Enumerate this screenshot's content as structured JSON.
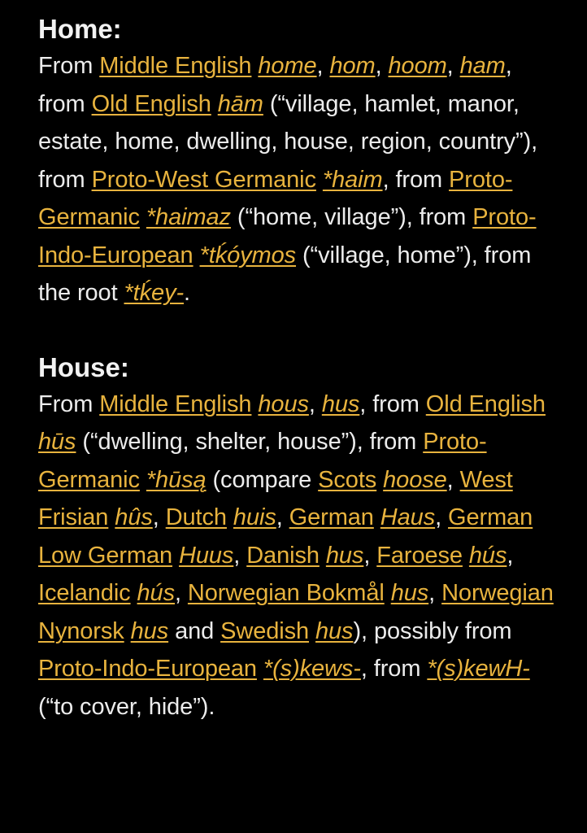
{
  "colors": {
    "background": "#000000",
    "text": "#ececec",
    "link": "#e8b33e"
  },
  "home": {
    "heading": "Home:",
    "body": [
      {
        "t": "From "
      },
      {
        "t": "Middle English",
        "link": true
      },
      {
        "t": " "
      },
      {
        "t": "home",
        "link": true,
        "italic": true
      },
      {
        "t": ", "
      },
      {
        "t": "hom",
        "link": true,
        "italic": true
      },
      {
        "t": ", "
      },
      {
        "t": "hoom",
        "link": true,
        "italic": true
      },
      {
        "t": ", "
      },
      {
        "t": "ham",
        "link": true,
        "italic": true
      },
      {
        "t": ", from "
      },
      {
        "t": "Old English",
        "link": true
      },
      {
        "t": " "
      },
      {
        "t": "hām",
        "link": true,
        "italic": true
      },
      {
        "t": " (“village, hamlet, manor, estate, home, dwelling, house, region, country”), from "
      },
      {
        "t": "Proto-West Germanic",
        "link": true
      },
      {
        "t": " "
      },
      {
        "t": "*haim",
        "link": true,
        "italic": true
      },
      {
        "t": ", from "
      },
      {
        "t": "Proto-Germanic",
        "link": true
      },
      {
        "t": " "
      },
      {
        "t": "*haimaz",
        "link": true,
        "italic": true
      },
      {
        "t": " (“home, village”), from "
      },
      {
        "t": "Proto-Indo-European",
        "link": true
      },
      {
        "t": " "
      },
      {
        "t": "*tḱóymos",
        "link": true,
        "italic": true
      },
      {
        "t": " (“village, home”), from the root "
      },
      {
        "t": "*tḱey-",
        "link": true,
        "italic": true
      },
      {
        "t": "."
      }
    ]
  },
  "house": {
    "heading": "House:",
    "body": [
      {
        "t": "From "
      },
      {
        "t": "Middle English",
        "link": true
      },
      {
        "t": " "
      },
      {
        "t": "hous",
        "link": true,
        "italic": true
      },
      {
        "t": ", "
      },
      {
        "t": "hus",
        "link": true,
        "italic": true
      },
      {
        "t": ", from "
      },
      {
        "t": "Old English",
        "link": true
      },
      {
        "t": " "
      },
      {
        "t": "hūs",
        "link": true,
        "italic": true
      },
      {
        "t": " (“dwelling, shelter, house”), from "
      },
      {
        "t": "Proto-Germanic",
        "link": true
      },
      {
        "t": " "
      },
      {
        "t": "*hūsą",
        "link": true,
        "italic": true
      },
      {
        "t": " (compare "
      },
      {
        "t": "Scots",
        "link": true
      },
      {
        "t": " "
      },
      {
        "t": "hoose",
        "link": true,
        "italic": true
      },
      {
        "t": ", "
      },
      {
        "t": "West Frisian",
        "link": true
      },
      {
        "t": " "
      },
      {
        "t": "hûs",
        "link": true,
        "italic": true
      },
      {
        "t": ", "
      },
      {
        "t": "Dutch",
        "link": true
      },
      {
        "t": " "
      },
      {
        "t": "huis",
        "link": true,
        "italic": true
      },
      {
        "t": ", "
      },
      {
        "t": "German",
        "link": true
      },
      {
        "t": " "
      },
      {
        "t": "Haus",
        "link": true,
        "italic": true
      },
      {
        "t": ", "
      },
      {
        "t": "German Low German",
        "link": true
      },
      {
        "t": " "
      },
      {
        "t": "Huus",
        "link": true,
        "italic": true
      },
      {
        "t": ", "
      },
      {
        "t": "Danish",
        "link": true
      },
      {
        "t": " "
      },
      {
        "t": "hus",
        "link": true,
        "italic": true
      },
      {
        "t": ", "
      },
      {
        "t": "Faroese",
        "link": true
      },
      {
        "t": " "
      },
      {
        "t": "hús",
        "link": true,
        "italic": true
      },
      {
        "t": ", "
      },
      {
        "t": "Icelandic",
        "link": true
      },
      {
        "t": " "
      },
      {
        "t": "hús",
        "link": true,
        "italic": true
      },
      {
        "t": ", "
      },
      {
        "t": "Norwegian Bokmål",
        "link": true
      },
      {
        "t": " "
      },
      {
        "t": "hus",
        "link": true,
        "italic": true
      },
      {
        "t": ", "
      },
      {
        "t": "Norwegian Nynorsk",
        "link": true
      },
      {
        "t": " "
      },
      {
        "t": "hus",
        "link": true,
        "italic": true
      },
      {
        "t": " and "
      },
      {
        "t": "Swedish",
        "link": true
      },
      {
        "t": " "
      },
      {
        "t": "hus",
        "link": true,
        "italic": true
      },
      {
        "t": "), possibly from "
      },
      {
        "t": "Proto-Indo-European",
        "link": true
      },
      {
        "t": " "
      },
      {
        "t": "*(s)kews-",
        "link": true,
        "italic": true
      },
      {
        "t": ", from "
      },
      {
        "t": "*(s)kewH-",
        "link": true,
        "italic": true
      },
      {
        "t": " (“to cover, hide”)."
      }
    ]
  }
}
